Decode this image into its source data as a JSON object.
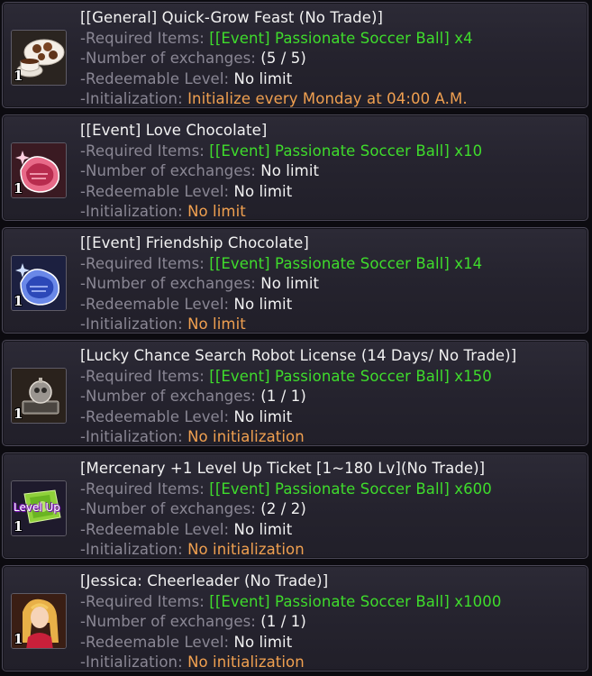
{
  "labels": {
    "required_items": "-Required Items: ",
    "number_of_exchanges": "-Number of exchanges: ",
    "redeemable_level": "-Redeemable Level: ",
    "initialization": "-Initialization: "
  },
  "items": [
    {
      "title": "[[General] Quick-Grow Feast (No Trade)]",
      "required": "[[Event] Passionate Soccer Ball] x4",
      "exchanges": "(5 / 5)",
      "level": "No limit",
      "initialization": "Initialize every Monday at 04:00 A.M.",
      "quantity": "1",
      "icon": "feast-icon"
    },
    {
      "title": "[[Event] Love Chocolate]",
      "required": "[[Event] Passionate Soccer Ball] x10",
      "exchanges": "No limit",
      "level": "No limit",
      "initialization": "No limit",
      "quantity": "1",
      "icon": "love-chocolate-icon"
    },
    {
      "title": "[[Event] Friendship Chocolate]",
      "required": "[[Event] Passionate Soccer Ball] x14",
      "exchanges": "No limit",
      "level": "No limit",
      "initialization": "No limit",
      "quantity": "1",
      "icon": "friendship-chocolate-icon"
    },
    {
      "title": "[Lucky Chance Search Robot License (14 Days/ No Trade)]",
      "required": "[[Event] Passionate Soccer Ball] x150",
      "exchanges": "(1 / 1)",
      "level": "No limit",
      "initialization": "No initialization",
      "quantity": "1",
      "icon": "robot-license-icon"
    },
    {
      "title": "[Mercenary +1 Level Up Ticket [1~180 Lv](No Trade)]",
      "required": "[[Event] Passionate Soccer Ball] x600",
      "exchanges": "(2 / 2)",
      "level": "No limit",
      "initialization": "No initialization",
      "quantity": "1",
      "badge": "Level Up",
      "icon": "level-up-ticket-icon"
    },
    {
      "title": "[Jessica: Cheerleader (No Trade)]",
      "required": "[[Event] Passionate Soccer Ball] x1000",
      "exchanges": "(1 / 1)",
      "level": "No limit",
      "initialization": "No initialization",
      "quantity": "1",
      "icon": "cheerleader-portrait-icon"
    }
  ]
}
